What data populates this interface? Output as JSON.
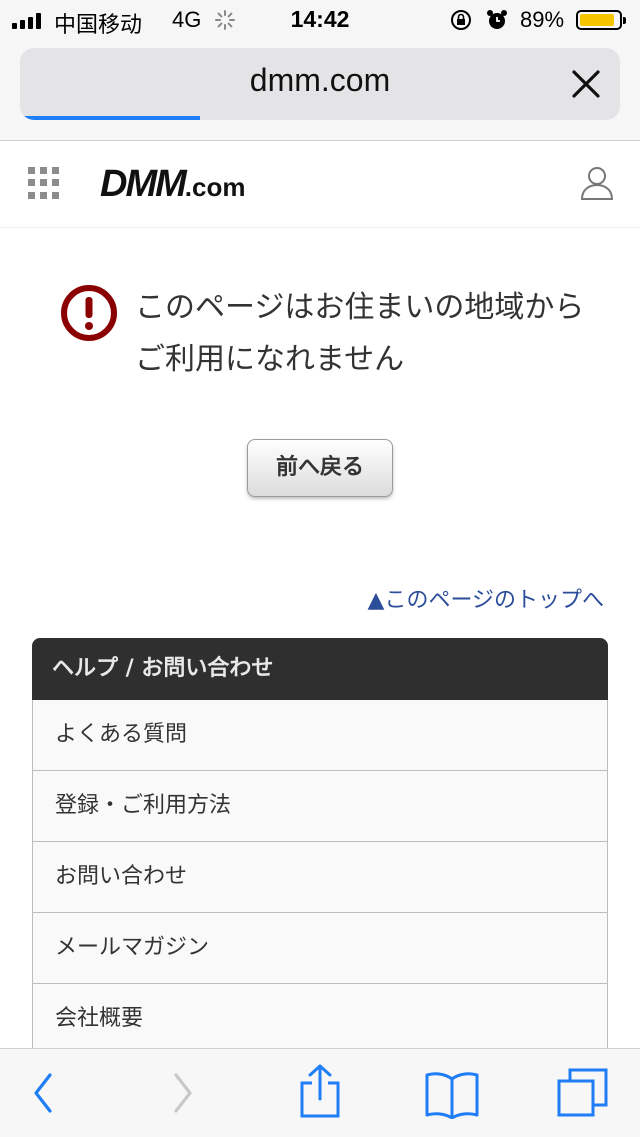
{
  "status_bar": {
    "carrier": "中国移动",
    "network": "4G",
    "time": "14:42",
    "battery": "89%",
    "battery_level": 0.89
  },
  "url_bar": {
    "url": "dmm.com",
    "load_progress": 0.3
  },
  "site": {
    "logo_main": "DMM",
    "logo_suffix": ".com"
  },
  "error": {
    "message": "このページはお住まいの地域からご利用になれません"
  },
  "back_button": "前へ戻る",
  "page_top_link": "このページのトップへ",
  "help": {
    "title": "ヘルプ / お問い合わせ",
    "items": [
      "よくある質問",
      "登録・ご利用方法",
      "お問い合わせ",
      "メールマガジン",
      "会社概要"
    ]
  },
  "colors": {
    "accent": "#1f7ef5",
    "link": "#2b4d9a",
    "error": "#8b0000",
    "panel_header": "#2f2f2f"
  }
}
